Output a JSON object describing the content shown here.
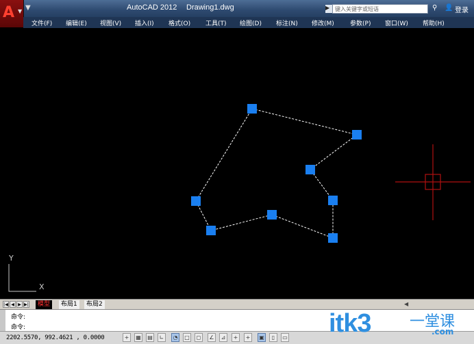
{
  "title": {
    "app": "AutoCAD 2012",
    "document": "Drawing1.dwg"
  },
  "search": {
    "placeholder": "键入关键字或短语"
  },
  "account": {
    "login_label": "登录"
  },
  "menu": [
    "文件(F)",
    "编辑(E)",
    "视图(V)",
    "插入(I)",
    "格式(O)",
    "工具(T)",
    "绘图(D)",
    "标注(N)",
    "修改(M)",
    "参数(P)",
    "窗口(W)",
    "帮助(H)"
  ],
  "ucs": {
    "x_label": "X",
    "y_label": "Y"
  },
  "tabs": {
    "model": "模型",
    "layout1": "布局1",
    "layout2": "布局2"
  },
  "command": {
    "line1": "命令:",
    "line2": "命令:"
  },
  "status": {
    "coordinates": "2202.5570,  992.4621 , 0.0000"
  },
  "watermark": {
    "brand": "itk3",
    "cn": "一堂课",
    "domain": ".com"
  },
  "colors": {
    "grip": "#1a7ff0",
    "crosshair": "#b01010",
    "canvas": "#000000",
    "polyline": "#ffffff"
  },
  "icons": [
    "autocad-logo-icon",
    "dropdown-icon",
    "search-arrow-icon",
    "binoculars-icon",
    "user-icon",
    "crosshair-cursor-icon",
    "ucs-icon"
  ]
}
